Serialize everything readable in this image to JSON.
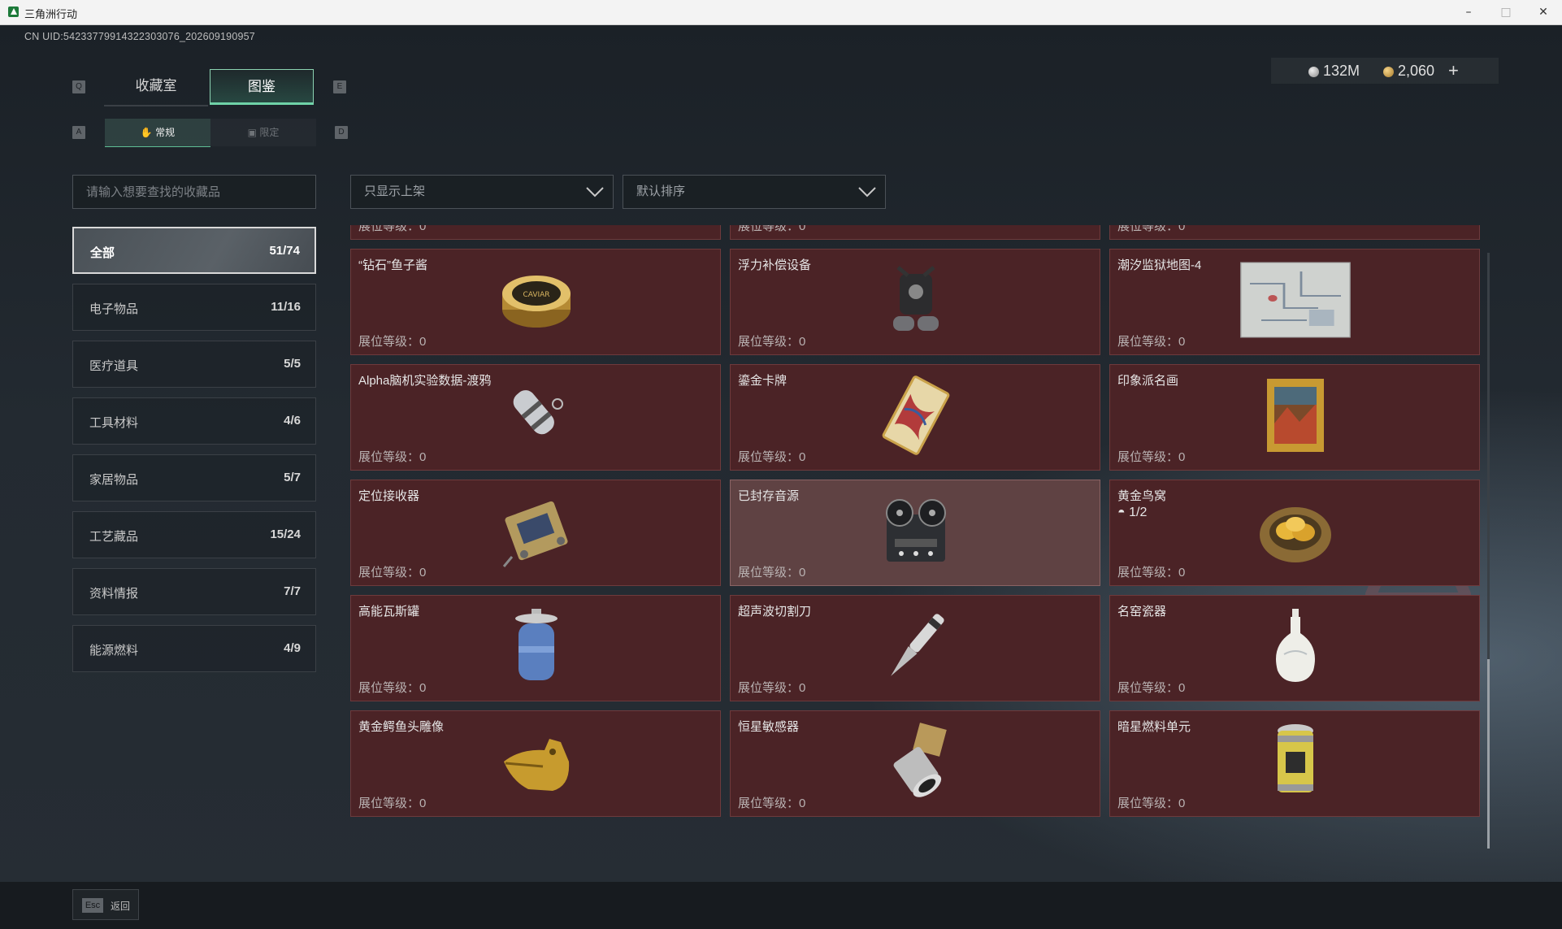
{
  "window": {
    "title": "三角洲行动",
    "minimize": "–",
    "maximize": "□",
    "close": "✕"
  },
  "uid": "CN UID:54233779914322303076_202609190957",
  "currency": {
    "silver": "132M",
    "gold": "2,060",
    "plus": "+"
  },
  "keys": {
    "prev_tab": "Q",
    "next_tab": "E",
    "prev_sub": "A",
    "next_sub": "D"
  },
  "tabs": [
    {
      "label": "收藏室"
    },
    {
      "label": "图鉴"
    }
  ],
  "subtabs": [
    {
      "label": "常规"
    },
    {
      "label": "限定"
    }
  ],
  "search": {
    "placeholder": "请输入想要查找的收藏品"
  },
  "filters": {
    "display": "只显示上架",
    "sort": "默认排序"
  },
  "categories": [
    {
      "label": "全部",
      "count": "51/74"
    },
    {
      "label": "电子物品",
      "count": "11/16"
    },
    {
      "label": "医疗道具",
      "count": "5/5"
    },
    {
      "label": "工具材料",
      "count": "4/6"
    },
    {
      "label": "家居物品",
      "count": "5/7"
    },
    {
      "label": "工艺藏品",
      "count": "15/24"
    },
    {
      "label": "资料情报",
      "count": "7/7"
    },
    {
      "label": "能源燃料",
      "count": "4/9"
    }
  ],
  "level_label": "展位等级：0",
  "items": [
    {
      "name": "“钻石”鱼子酱",
      "icon": "caviar-tin-icon"
    },
    {
      "name": "浮力补偿设备",
      "icon": "buoyancy-device-icon"
    },
    {
      "name": "潮汐监狱地图-4",
      "icon": "prison-map-icon"
    },
    {
      "name": "Alpha脑机实验数据-渡鸦",
      "icon": "data-capsule-icon"
    },
    {
      "name": "鎏金卡牌",
      "icon": "gilded-card-icon"
    },
    {
      "name": "印象派名画",
      "icon": "framed-painting-icon"
    },
    {
      "name": "定位接收器",
      "icon": "locator-receiver-icon"
    },
    {
      "name": "已封存音源",
      "icon": "reel-recorder-icon"
    },
    {
      "name": "黄金鸟窝",
      "sub": "1/2",
      "icon": "golden-nest-icon"
    },
    {
      "name": "高能瓦斯罐",
      "icon": "gas-canister-icon"
    },
    {
      "name": "超声波切割刀",
      "icon": "ultrasonic-cutter-icon"
    },
    {
      "name": "名窑瓷器",
      "icon": "porcelain-vase-icon"
    },
    {
      "name": "黄金鳄鱼头雕像",
      "icon": "gold-croc-statue-icon"
    },
    {
      "name": "恒星敏感器",
      "icon": "star-sensor-icon"
    },
    {
      "name": "暗星燃料单元",
      "icon": "fuel-cell-icon"
    }
  ],
  "footer": {
    "esc_key": "Esc",
    "back": "返回"
  }
}
